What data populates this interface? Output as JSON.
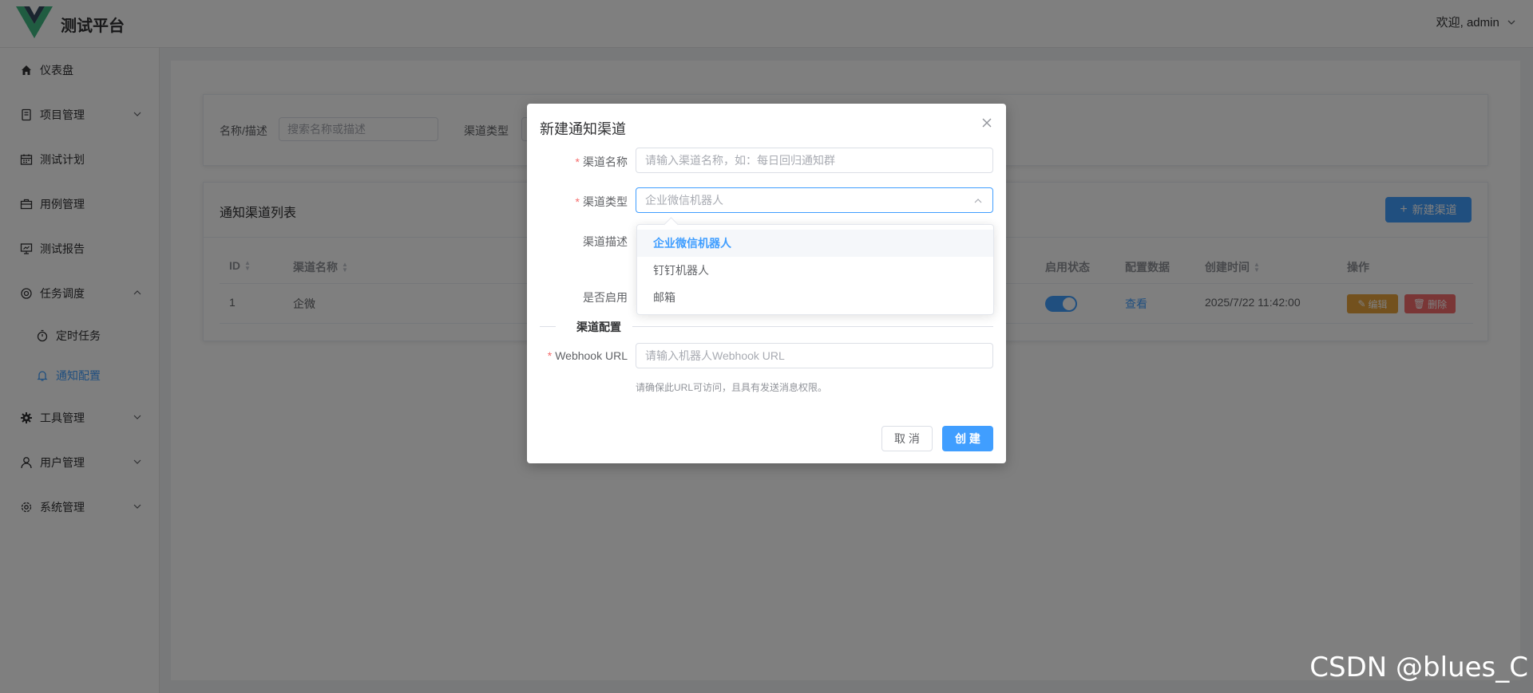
{
  "header": {
    "title": "测试平台",
    "welcome": "欢迎, admin"
  },
  "sidebar": {
    "items": [
      {
        "label": "仪表盘"
      },
      {
        "label": "项目管理"
      },
      {
        "label": "测试计划"
      },
      {
        "label": "用例管理"
      },
      {
        "label": "测试报告"
      },
      {
        "label": "任务调度"
      },
      {
        "label": "定时任务"
      },
      {
        "label": "通知配置"
      },
      {
        "label": "工具管理"
      },
      {
        "label": "用户管理"
      },
      {
        "label": "系统管理"
      }
    ]
  },
  "search": {
    "name_label": "名称/描述",
    "name_placeholder": "搜索名称或描述",
    "type_label": "渠道类型"
  },
  "list": {
    "title": "通知渠道列表",
    "new_button": "新建渠道",
    "columns": [
      "ID",
      "渠道名称",
      "启用状态",
      "配置数据",
      "创建时间",
      "操作"
    ],
    "rows": [
      {
        "id": "1",
        "name": "企微",
        "config": "查看",
        "created": "2025/7/22 11:42:00",
        "edit": "编辑",
        "delete": "删除"
      }
    ]
  },
  "dialog": {
    "title": "新建通知渠道",
    "name_label": "渠道名称",
    "name_placeholder": "请输入渠道名称，如：每日回归通知群",
    "type_label": "渠道类型",
    "type_value": "企业微信机器人",
    "desc_label": "渠道描述",
    "enable_label": "是否启用",
    "section_title": "渠道配置",
    "webhook_label": "Webhook URL",
    "webhook_placeholder": "请输入机器人Webhook URL",
    "hint": "请确保此URL可访问，且具有发送消息权限。",
    "cancel": "取 消",
    "create": "创 建"
  },
  "dropdown": {
    "options": [
      "企业微信机器人",
      "钉钉机器人",
      "邮箱"
    ]
  },
  "watermark": "CSDN @blues_C",
  "colors": {
    "primary": "#409eff",
    "warning": "#e6a23c",
    "danger": "#f56c6c"
  }
}
